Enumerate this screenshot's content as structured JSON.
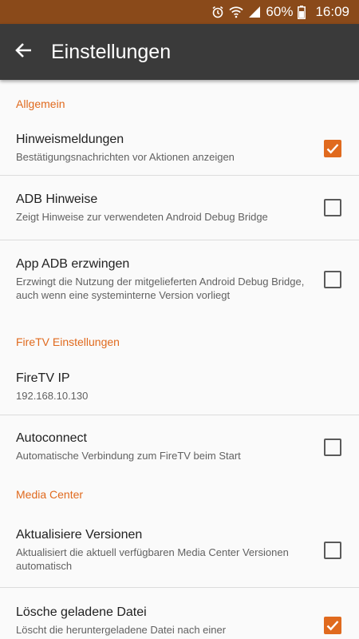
{
  "status_bar": {
    "battery": "60%",
    "time": "16:09",
    "icons": [
      "alarm-icon",
      "wifi-icon",
      "signal-icon",
      "battery-icon"
    ]
  },
  "app_bar": {
    "title": "Einstellungen",
    "back_icon": "arrow-left-icon"
  },
  "colors": {
    "accent": "#e06a1e",
    "status_bar": "#8a4a1a",
    "app_bar": "#3a3a3a",
    "background": "#fafafa"
  },
  "sections": [
    {
      "title": "Allgemein",
      "items": [
        {
          "title": "Hinweismeldungen",
          "summary": "Bestätigungsnachrichten vor Aktionen anzeigen",
          "checked": true
        },
        {
          "title": "ADB Hinweise",
          "summary": "Zeigt Hinweise zur verwendeten Android Debug Bridge",
          "checked": false
        },
        {
          "title": "App ADB erzwingen",
          "summary": "Erzwingt die Nutzung der mitgelieferten Android Debug Bridge, auch wenn eine systeminterne Version vorliegt",
          "checked": false
        }
      ]
    },
    {
      "title": "FireTV Einstellungen",
      "items": [
        {
          "title": "FireTV IP",
          "summary": "192.168.10.130"
        },
        {
          "title": "Autoconnect",
          "summary": "Automatische Verbindung zum FireTV beim Start",
          "checked": false
        }
      ]
    },
    {
      "title": "Media Center",
      "items": [
        {
          "title": "Aktualisiere Versionen",
          "summary": "Aktualisiert die aktuell verfügbaren Media Center Versionen automatisch",
          "checked": false
        },
        {
          "title": "Lösche geladene Datei",
          "summary": "Löscht die heruntergeladene Datei nach einer",
          "checked": true
        }
      ]
    }
  ]
}
